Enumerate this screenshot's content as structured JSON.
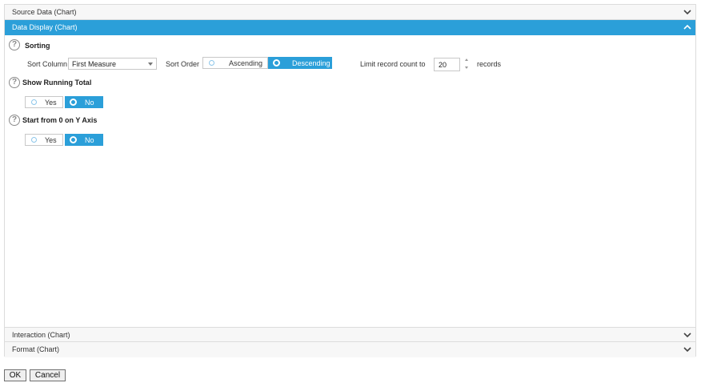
{
  "accordion": {
    "source_data": {
      "title": "Source Data (Chart)"
    },
    "data_display": {
      "title": "Data Display (Chart)"
    },
    "interaction": {
      "title": "Interaction (Chart)"
    },
    "format": {
      "title": "Format (Chart)"
    }
  },
  "sorting": {
    "title": "Sorting",
    "help": "?",
    "sort_column_label": "Sort Column",
    "sort_column_value": "First Measure",
    "sort_order_label": "Sort Order",
    "ascending_label": "Ascending",
    "descending_label": "Descending",
    "selected_order": "Descending",
    "limit_label": "Limit record count to",
    "limit_value": "20",
    "records_label": "records"
  },
  "running_total": {
    "title": "Show Running Total",
    "help": "?",
    "yes_label": "Yes",
    "no_label": "No",
    "selected": "No"
  },
  "start_zero": {
    "title": "Start from 0 on Y Axis",
    "help": "?",
    "yes_label": "Yes",
    "no_label": "No",
    "selected": "No"
  },
  "buttons": {
    "ok_label": "OK",
    "cancel_label": "Cancel"
  },
  "colors": {
    "accent": "#2b9fd9",
    "border": "#dcdcdc",
    "header_bg": "#f7f7f7"
  },
  "icons": {
    "collapsed": "chevron-down-icon",
    "expanded": "chevron-up-icon",
    "help": "help-icon"
  }
}
